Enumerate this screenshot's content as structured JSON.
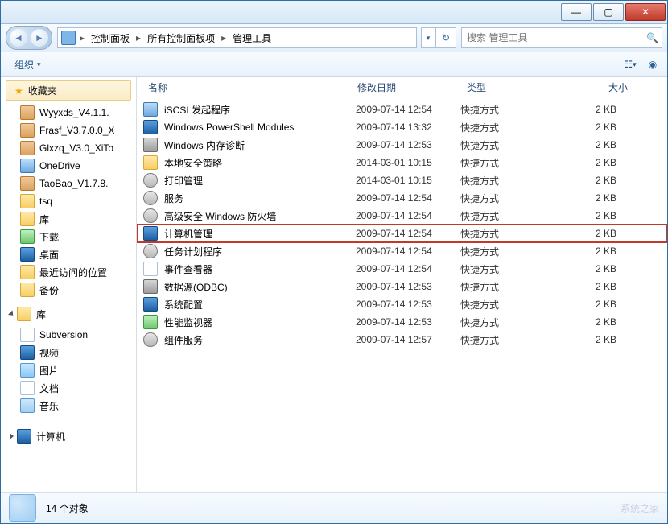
{
  "titlebar": {
    "min": "—",
    "max": "▢",
    "close": "✕"
  },
  "nav": {
    "breadcrumb": [
      "控制面板",
      "所有控制面板项",
      "管理工具"
    ],
    "search_placeholder": "搜索 管理工具"
  },
  "toolbar": {
    "organize": "组织",
    "organize_arrow": "▾"
  },
  "sidebar": {
    "favorites_label": "收藏夹",
    "fav_items": [
      "Wyyxds_V4.1.1.",
      "Frasf_V3.7.0.0_X",
      "Glxzq_V3.0_XiTo",
      "OneDrive",
      "TaoBao_V1.7.8.",
      "tsq",
      "库",
      "下载",
      "桌面",
      "最近访问的位置",
      "备份"
    ],
    "libraries_label": "库",
    "lib_items": [
      "Subversion",
      "视频",
      "图片",
      "文档",
      "音乐"
    ],
    "computer_label": "计算机"
  },
  "columns": {
    "name": "名称",
    "date": "修改日期",
    "type": "类型",
    "size": "大小"
  },
  "type_shortcut": "快捷方式",
  "files": [
    {
      "name": "iSCSI 发起程序",
      "date": "2009-07-14 12:54",
      "size": "2 KB",
      "icon": "ic-blue",
      "hl": false
    },
    {
      "name": "Windows PowerShell Modules",
      "date": "2009-07-14 13:32",
      "size": "2 KB",
      "icon": "ic-screen",
      "hl": false
    },
    {
      "name": "Windows 内存诊断",
      "date": "2009-07-14 12:53",
      "size": "2 KB",
      "icon": "ic-drive",
      "hl": false
    },
    {
      "name": "本地安全策略",
      "date": "2014-03-01 10:15",
      "size": "2 KB",
      "icon": "ic-folder",
      "hl": false
    },
    {
      "name": "打印管理",
      "date": "2014-03-01 10:15",
      "size": "2 KB",
      "icon": "ic-gear",
      "hl": false
    },
    {
      "name": "服务",
      "date": "2009-07-14 12:54",
      "size": "2 KB",
      "icon": "ic-gear",
      "hl": false
    },
    {
      "name": "高级安全 Windows 防火墙",
      "date": "2009-07-14 12:54",
      "size": "2 KB",
      "icon": "ic-gear",
      "hl": false
    },
    {
      "name": "计算机管理",
      "date": "2009-07-14 12:54",
      "size": "2 KB",
      "icon": "ic-screen",
      "hl": true
    },
    {
      "name": "任务计划程序",
      "date": "2009-07-14 12:54",
      "size": "2 KB",
      "icon": "ic-gear",
      "hl": false
    },
    {
      "name": "事件查看器",
      "date": "2009-07-14 12:54",
      "size": "2 KB",
      "icon": "ic-doc",
      "hl": false
    },
    {
      "name": "数据源(ODBC)",
      "date": "2009-07-14 12:53",
      "size": "2 KB",
      "icon": "ic-drive",
      "hl": false
    },
    {
      "name": "系统配置",
      "date": "2009-07-14 12:53",
      "size": "2 KB",
      "icon": "ic-screen",
      "hl": false
    },
    {
      "name": "性能监视器",
      "date": "2009-07-14 12:53",
      "size": "2 KB",
      "icon": "ic-green",
      "hl": false
    },
    {
      "name": "组件服务",
      "date": "2009-07-14 12:57",
      "size": "2 KB",
      "icon": "ic-gear",
      "hl": false
    }
  ],
  "status": {
    "count": "14 个对象"
  },
  "watermark": "系统之家"
}
